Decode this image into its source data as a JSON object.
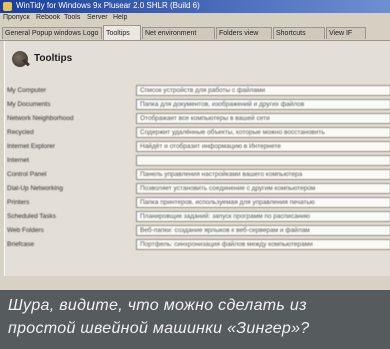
{
  "window": {
    "title": "WinTidy for Windows 9x Plusear 2.0 SHLR (Build 6)"
  },
  "menu": {
    "items": [
      "Пропуск",
      "Rebook",
      "Tools",
      "Server",
      "Help"
    ]
  },
  "tabs": [
    {
      "label": "General Popup windows Logo"
    },
    {
      "label": "Tooltips",
      "active": true
    },
    {
      "label": "Net environment"
    },
    {
      "label": "Folders view"
    },
    {
      "label": "Shortcuts"
    },
    {
      "label": "View IF"
    }
  ],
  "panel": {
    "title": "Tooltips",
    "rows": [
      {
        "label": "My Computer",
        "value": "Список устройств для работы с файлами"
      },
      {
        "label": "My Documents",
        "value": "Папка для документов, изображений и других файлов"
      },
      {
        "label": "Network Neighborhood",
        "value": "Отображает все компьютеры в вашей сети"
      },
      {
        "label": "Recycled",
        "value": "Содержит удалённые объекты, которые можно восстановить"
      },
      {
        "label": "Internet Explorer",
        "value": "Найдёт и отобразит информацию в Интернете"
      },
      {
        "label": "Internet",
        "value": ""
      },
      {
        "label": "Control Panel",
        "value": "Панель управления настройками вашего компьютера"
      },
      {
        "label": "Dial-Up Networking",
        "value": "Позволяет установить соединение с другим компьютером"
      },
      {
        "label": "Printers",
        "value": "Папка принтеров, используемая для управления печатью"
      },
      {
        "label": "Scheduled Tasks",
        "value": "Планировщик заданий: запуск программ по расписанию"
      },
      {
        "label": "Web Folders",
        "value": "Веб-папки: создание ярлыков к веб-серверам и файлам"
      },
      {
        "label": "Briefcase",
        "value": "Портфель: синхронизация файлов между компьютерами"
      }
    ]
  },
  "caption": {
    "line1": "Шура, видите, что можно сделать из",
    "line2": "простой швейной машинки «Зингер»?"
  }
}
